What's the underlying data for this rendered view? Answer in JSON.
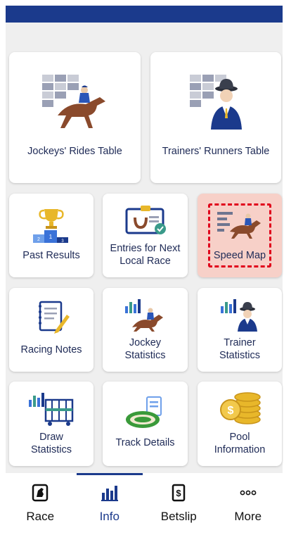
{
  "header": {
    "bar_color": "#1b3a8c"
  },
  "tiles": {
    "jockeys_rides": "Jockeys' Rides Table",
    "trainers_runners": "Trainers' Runners Table",
    "past_results": "Past Results",
    "entries_line1": "Entries for Next",
    "entries_line2": "Local Race",
    "speed_map": "Speed Map",
    "racing_notes": "Racing Notes",
    "jockey_stats_line1": "Jockey",
    "jockey_stats_line2": "Statistics",
    "trainer_stats_line1": "Trainer",
    "trainer_stats_line2": "Statistics",
    "draw_stats_line1": "Draw",
    "draw_stats_line2": "Statistics",
    "track_details": "Track Details",
    "pool_info_line1": "Pool",
    "pool_info_line2": "Information"
  },
  "podium": {
    "first": "1",
    "second": "2",
    "third": "3"
  },
  "bottom_nav": {
    "items": [
      {
        "label": "Race",
        "icon": "horse-head-icon"
      },
      {
        "label": "Info",
        "icon": "bar-chart-icon"
      },
      {
        "label": "Betslip",
        "icon": "dollar-slip-icon"
      },
      {
        "label": "More",
        "icon": "more-dots-icon"
      }
    ],
    "active": "Info"
  },
  "colors": {
    "navy": "#1b3a8c",
    "text": "#1e2a56",
    "highlight_bg": "#f7d0c8",
    "highlight_border": "#e0001b",
    "gold": "#e8b72a",
    "horse_brown": "#8a4a2c",
    "track_green": "#3a9a3a"
  }
}
